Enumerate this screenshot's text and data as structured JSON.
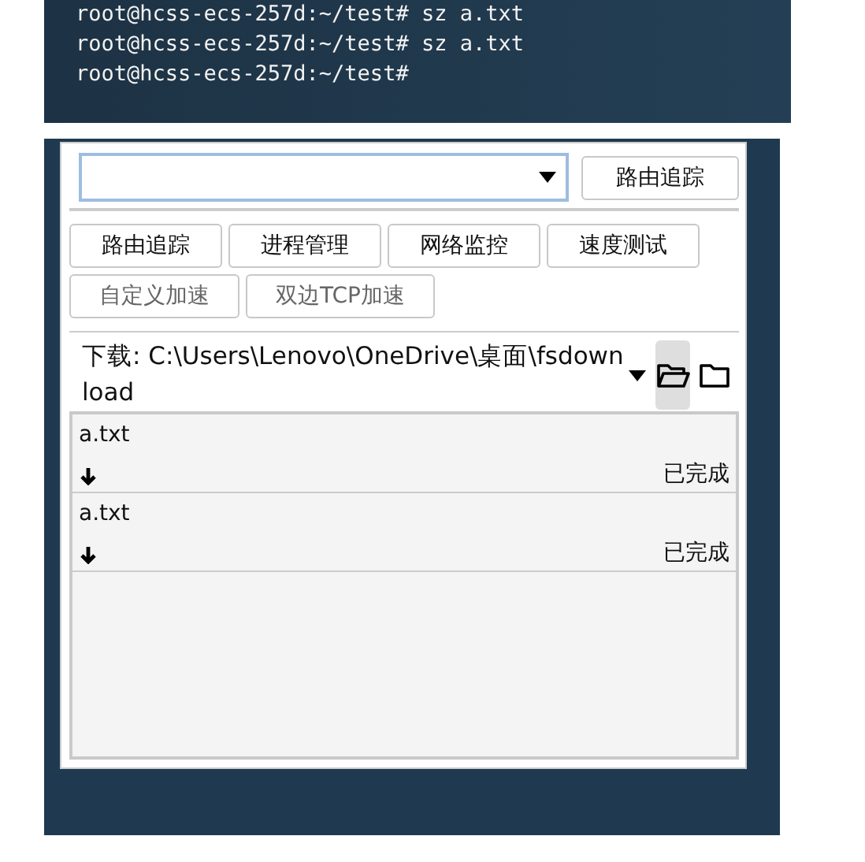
{
  "terminal": {
    "lines": [
      "root@hcss-ecs-257d:~/test# sz a.txt",
      "root@hcss-ecs-257d:~/test# sz a.txt",
      "root@hcss-ecs-257d:~/test#"
    ]
  },
  "route_button": "路由追踪",
  "tool_buttons": [
    {
      "label": "路由追踪",
      "disabled": false
    },
    {
      "label": "进程管理",
      "disabled": false
    },
    {
      "label": "网络监控",
      "disabled": false
    },
    {
      "label": "速度测试",
      "disabled": false
    },
    {
      "label": "自定义加速",
      "disabled": true
    },
    {
      "label": "双边TCP加速",
      "disabled": true
    }
  ],
  "download": {
    "path": "下载: C:\\Users\\Lenovo\\OneDrive\\桌面\\fsdownload",
    "folder_buttons": [
      {
        "kind": "open",
        "selected": true
      },
      {
        "kind": "closed",
        "selected": false
      }
    ]
  },
  "transfers": [
    {
      "file": "a.txt",
      "kind": "download",
      "status": "已完成"
    },
    {
      "file": "a.txt",
      "kind": "download",
      "status": "已完成"
    }
  ]
}
